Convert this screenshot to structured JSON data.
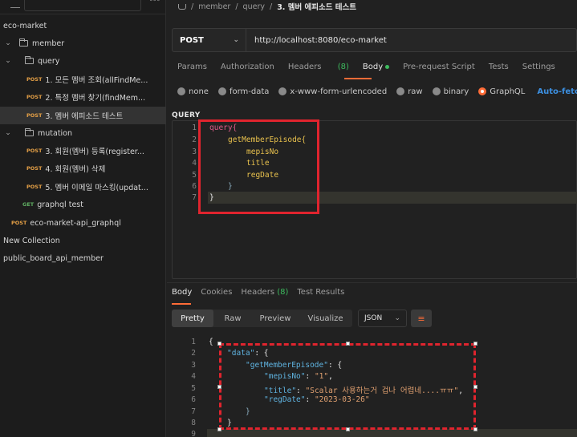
{
  "sidebar": {
    "workspace": "eco-market",
    "items": [
      {
        "label": "member",
        "type": "folder",
        "expanded": true
      },
      {
        "label": "query",
        "type": "folder",
        "expanded": true
      },
      {
        "method": "POST",
        "label": "1. 모든 멤버 조회(allFindMe..."
      },
      {
        "method": "POST",
        "label": "2. 특정 멤버 찾기(findMem..."
      },
      {
        "method": "POST",
        "label": "3. 멤버 에피소드 테스트",
        "selected": true
      },
      {
        "label": "mutation",
        "type": "folder",
        "expanded": true
      },
      {
        "method": "POST",
        "label": "3. 회원(멤버) 등록(register..."
      },
      {
        "method": "POST",
        "label": "4. 회원(멤버) 삭제"
      },
      {
        "method": "POST",
        "label": "5. 멤버 이메일 마스킹(updat..."
      },
      {
        "method": "GET",
        "label": "graphql test"
      },
      {
        "method": "POST",
        "label": "eco-market-api_graphql"
      },
      {
        "label": "New Collection"
      },
      {
        "label": "public_board_api_member"
      }
    ]
  },
  "breadcrumb": {
    "sep": "/",
    "parts": [
      "member",
      "query"
    ],
    "current": "3. 멤버 에피소드 테스트"
  },
  "request": {
    "method": "POST",
    "url": "http://localhost:8080/eco-market"
  },
  "tabs": {
    "params": "Params",
    "authorization": "Authorization",
    "headers": "Headers",
    "headers_count": "(8)",
    "body": "Body",
    "prerequest": "Pre-request Script",
    "tests": "Tests",
    "settings": "Settings"
  },
  "body_types": {
    "none": "none",
    "formdata": "form-data",
    "urlencoded": "x-www-form-urlencoded",
    "raw": "raw",
    "binary": "binary",
    "graphql": "GraphQL",
    "selected": "GraphQL",
    "autofetch": "Auto-fetch"
  },
  "query_section": {
    "label": "QUERY",
    "line_numbers": [
      "1",
      "2",
      "3",
      "4",
      "5",
      "6",
      "7"
    ],
    "lines": [
      "query{",
      "getMemberEpisode{",
      "mepisNo",
      "title",
      "regDate",
      "}",
      "}"
    ]
  },
  "response": {
    "tabs": {
      "body": "Body",
      "cookies": "Cookies",
      "headers": "Headers",
      "headers_count": "(8)",
      "test_results": "Test Results"
    },
    "views": [
      "Pretty",
      "Raw",
      "Preview",
      "Visualize"
    ],
    "active_view": "Pretty",
    "format": "JSON",
    "line_numbers": [
      "1",
      "2",
      "3",
      "4",
      "5",
      "6",
      "7",
      "8",
      "9"
    ],
    "json": {
      "open": "{",
      "data_key": "\"data\"",
      "episode_key": "\"getMemberEpisode\"",
      "mepisNo_key": "\"mepisNo\"",
      "mepisNo_val": "\"1\"",
      "title_key": "\"title\"",
      "title_val": "\"Scalar 사용하는거 겁나 어렵네....ㅠㅠ\"",
      "regDate_key": "\"regDate\"",
      "regDate_val": "\"2023-03-26\"",
      "close": "}"
    }
  },
  "colors": {
    "accent": "#ff6c37",
    "highlight_box": "#e0242e",
    "post": "#e5a046",
    "get": "#5fae62",
    "link": "#3c8fe0"
  }
}
